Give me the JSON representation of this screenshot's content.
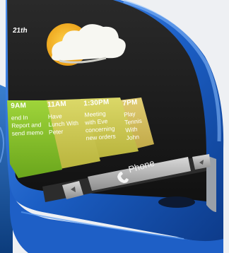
{
  "device": {
    "date_label": "21th",
    "weather_icon": "partly-cloudy-icon",
    "phone_button_label": "Phone",
    "colors": {
      "frame_blue": "#1f63c8",
      "screen_dark": "#1b1b1b",
      "card_green": "#8cc22c",
      "card_yellow": "#d2cf55",
      "card_gold": "#d7c25e"
    }
  },
  "timeline_cards": [
    {
      "time": "9AM",
      "lines": [
        "end In",
        "Report and",
        "send memo"
      ]
    },
    {
      "time": "11AM",
      "lines": [
        "Have",
        "Lunch With",
        "Peter"
      ]
    },
    {
      "time": "1:30PM",
      "lines": [
        "Meeting",
        "with Eve",
        "concerning",
        "new orders"
      ]
    },
    {
      "time": "7PM",
      "lines": [
        "Play",
        "Tennis",
        "With",
        "John"
      ]
    }
  ]
}
